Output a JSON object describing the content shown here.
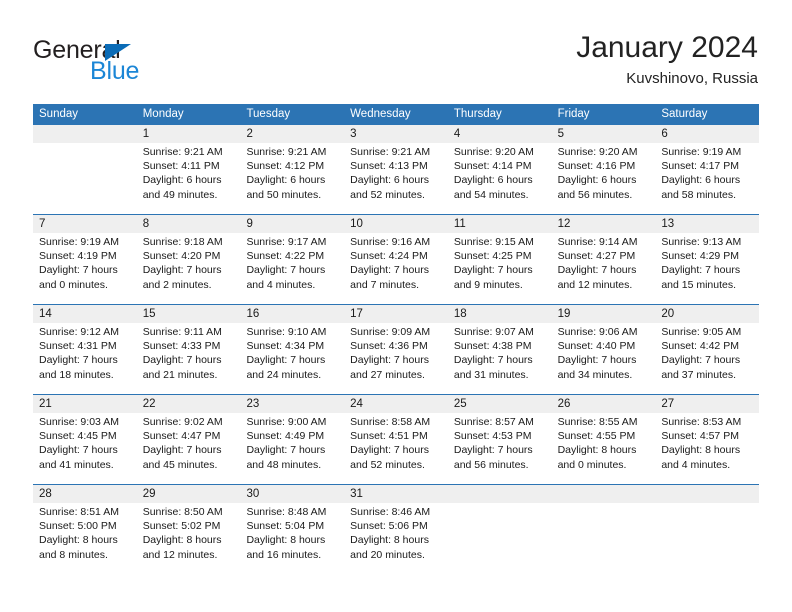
{
  "brand": {
    "name_dark": "General",
    "name_blue": "Blue",
    "triangle_icon": "triangle-icon",
    "accent_blue": "#1b86d6",
    "logo_blue": "#0b6cb7"
  },
  "header": {
    "title": "January 2024",
    "subtitle": "Kuvshinovo, Russia"
  },
  "colors": {
    "header_blue": "#2c74b4",
    "daynum_band": "#efefef",
    "text": "#1a1a1a"
  },
  "weekdays": [
    "Sunday",
    "Monday",
    "Tuesday",
    "Wednesday",
    "Thursday",
    "Friday",
    "Saturday"
  ],
  "weeks": [
    {
      "days": [
        {
          "num": "",
          "empty": true,
          "sunrise": "",
          "sunset": "",
          "daylight1": "",
          "daylight2": ""
        },
        {
          "num": "1",
          "sunrise": "Sunrise: 9:21 AM",
          "sunset": "Sunset: 4:11 PM",
          "daylight1": "Daylight: 6 hours",
          "daylight2": "and 49 minutes."
        },
        {
          "num": "2",
          "sunrise": "Sunrise: 9:21 AM",
          "sunset": "Sunset: 4:12 PM",
          "daylight1": "Daylight: 6 hours",
          "daylight2": "and 50 minutes."
        },
        {
          "num": "3",
          "sunrise": "Sunrise: 9:21 AM",
          "sunset": "Sunset: 4:13 PM",
          "daylight1": "Daylight: 6 hours",
          "daylight2": "and 52 minutes."
        },
        {
          "num": "4",
          "sunrise": "Sunrise: 9:20 AM",
          "sunset": "Sunset: 4:14 PM",
          "daylight1": "Daylight: 6 hours",
          "daylight2": "and 54 minutes."
        },
        {
          "num": "5",
          "sunrise": "Sunrise: 9:20 AM",
          "sunset": "Sunset: 4:16 PM",
          "daylight1": "Daylight: 6 hours",
          "daylight2": "and 56 minutes."
        },
        {
          "num": "6",
          "sunrise": "Sunrise: 9:19 AM",
          "sunset": "Sunset: 4:17 PM",
          "daylight1": "Daylight: 6 hours",
          "daylight2": "and 58 minutes."
        }
      ]
    },
    {
      "days": [
        {
          "num": "7",
          "sunrise": "Sunrise: 9:19 AM",
          "sunset": "Sunset: 4:19 PM",
          "daylight1": "Daylight: 7 hours",
          "daylight2": "and 0 minutes."
        },
        {
          "num": "8",
          "sunrise": "Sunrise: 9:18 AM",
          "sunset": "Sunset: 4:20 PM",
          "daylight1": "Daylight: 7 hours",
          "daylight2": "and 2 minutes."
        },
        {
          "num": "9",
          "sunrise": "Sunrise: 9:17 AM",
          "sunset": "Sunset: 4:22 PM",
          "daylight1": "Daylight: 7 hours",
          "daylight2": "and 4 minutes."
        },
        {
          "num": "10",
          "sunrise": "Sunrise: 9:16 AM",
          "sunset": "Sunset: 4:24 PM",
          "daylight1": "Daylight: 7 hours",
          "daylight2": "and 7 minutes."
        },
        {
          "num": "11",
          "sunrise": "Sunrise: 9:15 AM",
          "sunset": "Sunset: 4:25 PM",
          "daylight1": "Daylight: 7 hours",
          "daylight2": "and 9 minutes."
        },
        {
          "num": "12",
          "sunrise": "Sunrise: 9:14 AM",
          "sunset": "Sunset: 4:27 PM",
          "daylight1": "Daylight: 7 hours",
          "daylight2": "and 12 minutes."
        },
        {
          "num": "13",
          "sunrise": "Sunrise: 9:13 AM",
          "sunset": "Sunset: 4:29 PM",
          "daylight1": "Daylight: 7 hours",
          "daylight2": "and 15 minutes."
        }
      ]
    },
    {
      "days": [
        {
          "num": "14",
          "sunrise": "Sunrise: 9:12 AM",
          "sunset": "Sunset: 4:31 PM",
          "daylight1": "Daylight: 7 hours",
          "daylight2": "and 18 minutes."
        },
        {
          "num": "15",
          "sunrise": "Sunrise: 9:11 AM",
          "sunset": "Sunset: 4:33 PM",
          "daylight1": "Daylight: 7 hours",
          "daylight2": "and 21 minutes."
        },
        {
          "num": "16",
          "sunrise": "Sunrise: 9:10 AM",
          "sunset": "Sunset: 4:34 PM",
          "daylight1": "Daylight: 7 hours",
          "daylight2": "and 24 minutes."
        },
        {
          "num": "17",
          "sunrise": "Sunrise: 9:09 AM",
          "sunset": "Sunset: 4:36 PM",
          "daylight1": "Daylight: 7 hours",
          "daylight2": "and 27 minutes."
        },
        {
          "num": "18",
          "sunrise": "Sunrise: 9:07 AM",
          "sunset": "Sunset: 4:38 PM",
          "daylight1": "Daylight: 7 hours",
          "daylight2": "and 31 minutes."
        },
        {
          "num": "19",
          "sunrise": "Sunrise: 9:06 AM",
          "sunset": "Sunset: 4:40 PM",
          "daylight1": "Daylight: 7 hours",
          "daylight2": "and 34 minutes."
        },
        {
          "num": "20",
          "sunrise": "Sunrise: 9:05 AM",
          "sunset": "Sunset: 4:42 PM",
          "daylight1": "Daylight: 7 hours",
          "daylight2": "and 37 minutes."
        }
      ]
    },
    {
      "days": [
        {
          "num": "21",
          "sunrise": "Sunrise: 9:03 AM",
          "sunset": "Sunset: 4:45 PM",
          "daylight1": "Daylight: 7 hours",
          "daylight2": "and 41 minutes."
        },
        {
          "num": "22",
          "sunrise": "Sunrise: 9:02 AM",
          "sunset": "Sunset: 4:47 PM",
          "daylight1": "Daylight: 7 hours",
          "daylight2": "and 45 minutes."
        },
        {
          "num": "23",
          "sunrise": "Sunrise: 9:00 AM",
          "sunset": "Sunset: 4:49 PM",
          "daylight1": "Daylight: 7 hours",
          "daylight2": "and 48 minutes."
        },
        {
          "num": "24",
          "sunrise": "Sunrise: 8:58 AM",
          "sunset": "Sunset: 4:51 PM",
          "daylight1": "Daylight: 7 hours",
          "daylight2": "and 52 minutes."
        },
        {
          "num": "25",
          "sunrise": "Sunrise: 8:57 AM",
          "sunset": "Sunset: 4:53 PM",
          "daylight1": "Daylight: 7 hours",
          "daylight2": "and 56 minutes."
        },
        {
          "num": "26",
          "sunrise": "Sunrise: 8:55 AM",
          "sunset": "Sunset: 4:55 PM",
          "daylight1": "Daylight: 8 hours",
          "daylight2": "and 0 minutes."
        },
        {
          "num": "27",
          "sunrise": "Sunrise: 8:53 AM",
          "sunset": "Sunset: 4:57 PM",
          "daylight1": "Daylight: 8 hours",
          "daylight2": "and 4 minutes."
        }
      ]
    },
    {
      "days": [
        {
          "num": "28",
          "sunrise": "Sunrise: 8:51 AM",
          "sunset": "Sunset: 5:00 PM",
          "daylight1": "Daylight: 8 hours",
          "daylight2": "and 8 minutes."
        },
        {
          "num": "29",
          "sunrise": "Sunrise: 8:50 AM",
          "sunset": "Sunset: 5:02 PM",
          "daylight1": "Daylight: 8 hours",
          "daylight2": "and 12 minutes."
        },
        {
          "num": "30",
          "sunrise": "Sunrise: 8:48 AM",
          "sunset": "Sunset: 5:04 PM",
          "daylight1": "Daylight: 8 hours",
          "daylight2": "and 16 minutes."
        },
        {
          "num": "31",
          "sunrise": "Sunrise: 8:46 AM",
          "sunset": "Sunset: 5:06 PM",
          "daylight1": "Daylight: 8 hours",
          "daylight2": "and 20 minutes."
        },
        {
          "num": "",
          "empty": true,
          "sunrise": "",
          "sunset": "",
          "daylight1": "",
          "daylight2": ""
        },
        {
          "num": "",
          "empty": true,
          "sunrise": "",
          "sunset": "",
          "daylight1": "",
          "daylight2": ""
        },
        {
          "num": "",
          "empty": true,
          "sunrise": "",
          "sunset": "",
          "daylight1": "",
          "daylight2": ""
        }
      ]
    }
  ]
}
